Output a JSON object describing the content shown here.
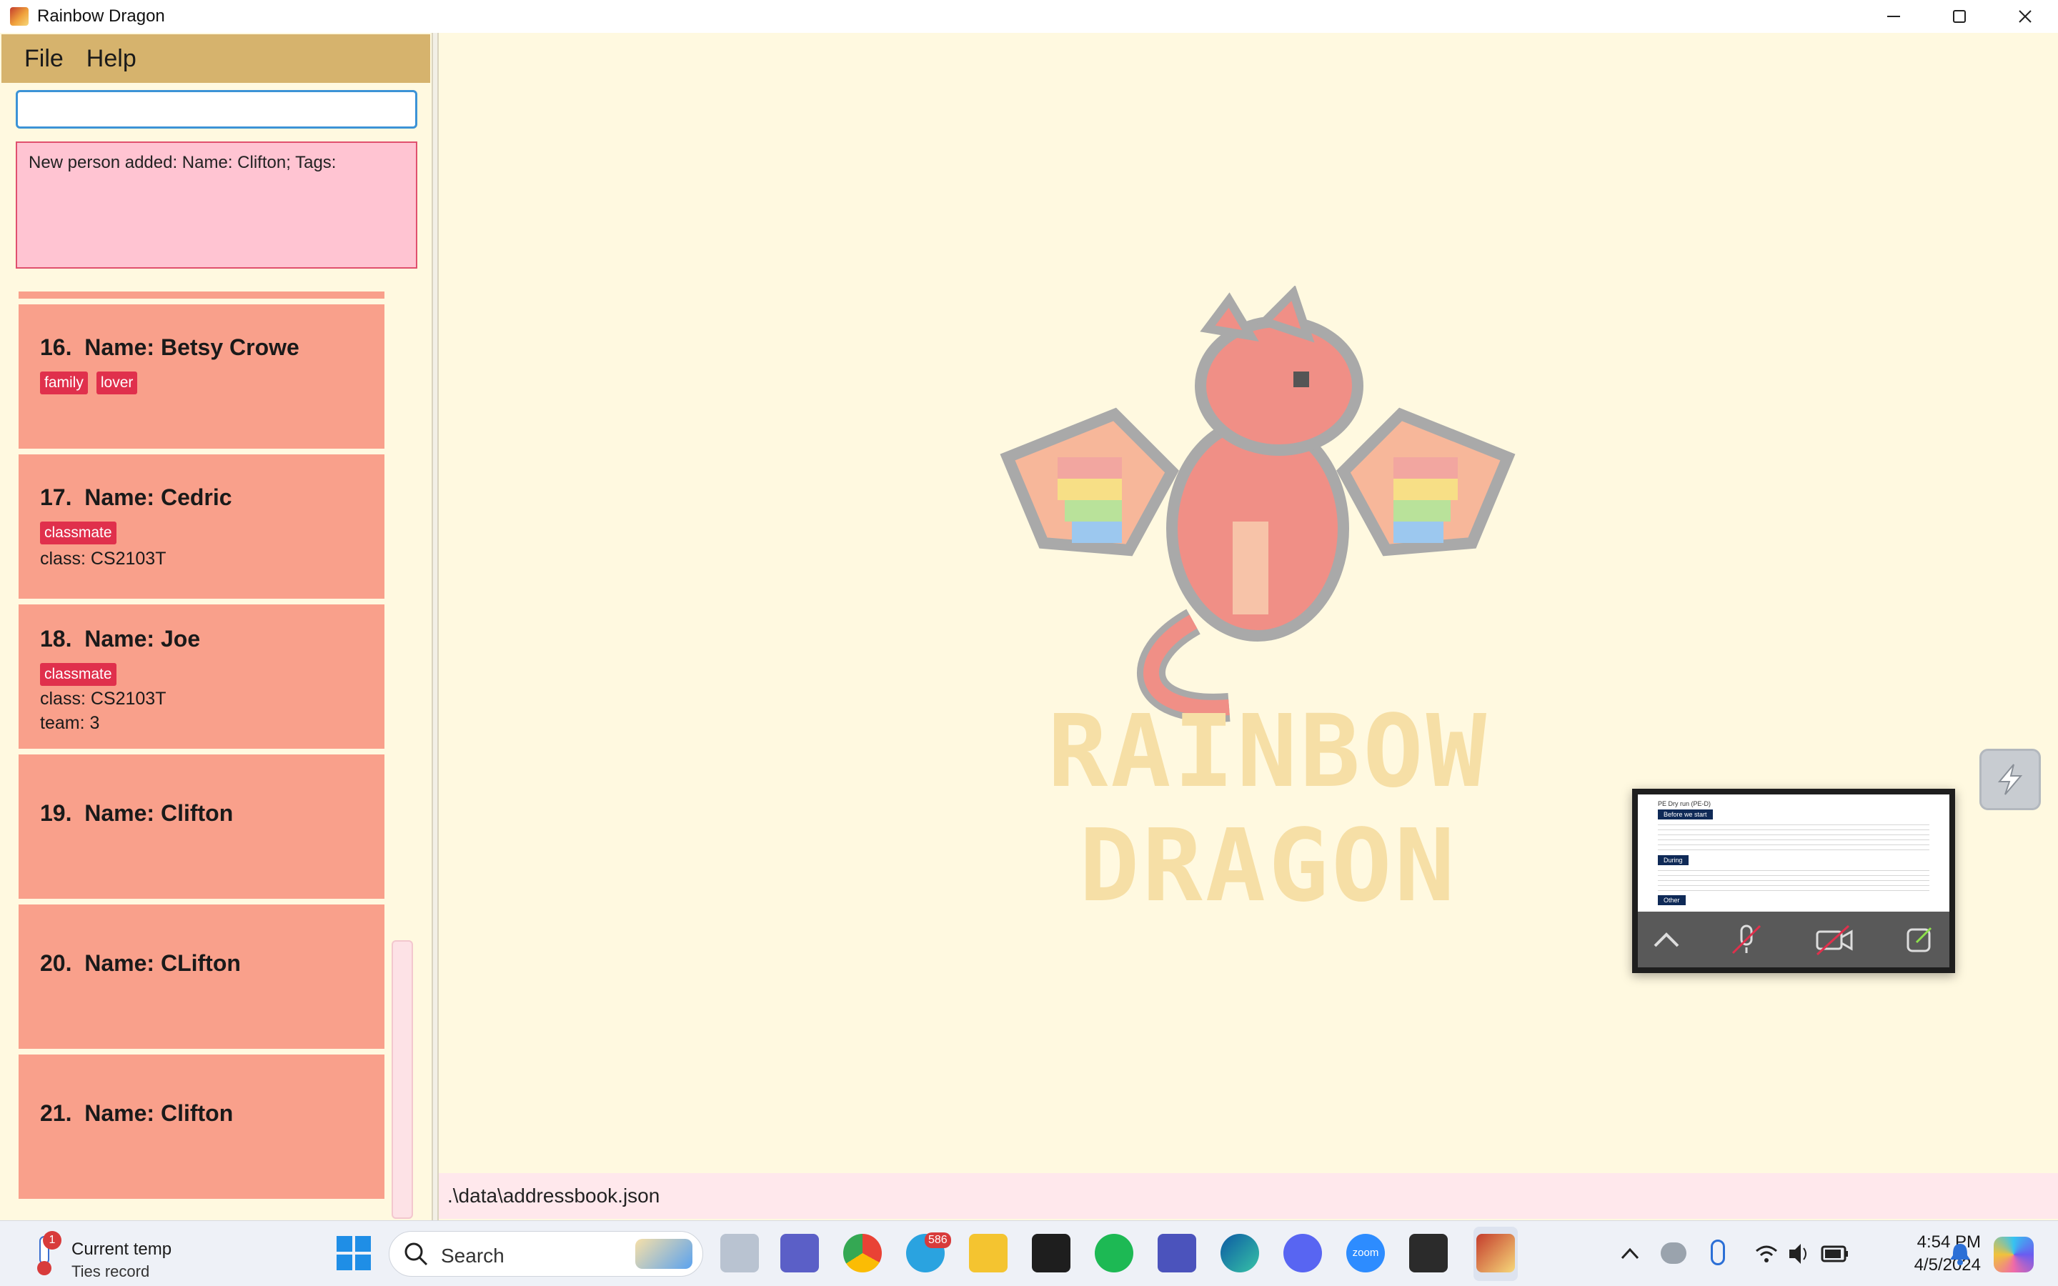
{
  "window": {
    "title": "Rainbow Dragon"
  },
  "menu": {
    "file": "File",
    "help": "Help"
  },
  "command": {
    "value": "",
    "placeholder": ""
  },
  "result_display": {
    "text": "New person added: Name: Clifton; Tags:"
  },
  "persons": [
    {
      "index": "16.",
      "name": "Name: Betsy Crowe",
      "tags": [
        "family",
        "lover"
      ],
      "details": []
    },
    {
      "index": "17.",
      "name": "Name: Cedric",
      "tags": [
        "classmate"
      ],
      "details": [
        "class: CS2103T"
      ]
    },
    {
      "index": "18.",
      "name": "Name: Joe",
      "tags": [
        "classmate"
      ],
      "details": [
        "class: CS2103T",
        "team: 3"
      ]
    },
    {
      "index": "19.",
      "name": "Name: Clifton",
      "tags": [],
      "details": []
    },
    {
      "index": "20.",
      "name": "Name: CLifton",
      "tags": [],
      "details": []
    },
    {
      "index": "21.",
      "name": "Name: Clifton",
      "tags": [],
      "details": []
    }
  ],
  "status_bar": {
    "path": ".\\data\\addressbook.json"
  },
  "logo": {
    "line1": "RAINBOW",
    "line2": "DRAGON"
  },
  "pip": {
    "heading": "PE Dry run (PE-D)",
    "section1": "Before we start",
    "section2": "During",
    "section3": "Other"
  },
  "taskbar": {
    "weather_title": "Current temp",
    "weather_sub": "Ties record",
    "weather_badge": "1",
    "search_label": "Search",
    "telegram_badge": "586",
    "zoom_label": "zoom",
    "time": "4:54 PM",
    "date": "4/5/2024"
  },
  "colors": {
    "menubar": "#d6b36d",
    "card": "#f9a08b",
    "tag": "#e0304c",
    "result_bg": "#ffc4d2",
    "background": "#fff9e0"
  }
}
